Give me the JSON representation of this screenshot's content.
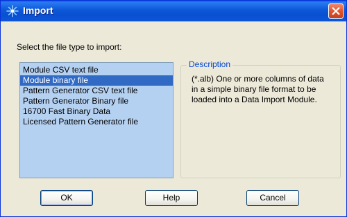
{
  "window": {
    "title": "Import"
  },
  "prompt": "Select the file type to import:",
  "file_types": [
    {
      "label": "Module CSV text file",
      "selected": false
    },
    {
      "label": "Module binary file",
      "selected": true
    },
    {
      "label": "Pattern Generator CSV text file",
      "selected": false
    },
    {
      "label": "Pattern Generator Binary file",
      "selected": false
    },
    {
      "label": "16700 Fast Binary Data",
      "selected": false
    },
    {
      "label": "Licensed Pattern Generator file",
      "selected": false
    }
  ],
  "description": {
    "title": "Description",
    "text": "(*.alb) One or more columns of data in a simple binary file format to be loaded into a Data Import Module."
  },
  "buttons": {
    "ok": "OK",
    "help": "Help",
    "cancel": "Cancel"
  },
  "colors": {
    "selection": "#316ac5",
    "listbox_bg": "#b5d1f2",
    "group_title": "#0046d5",
    "dialog_bg": "#ece9d8"
  },
  "icons": {
    "title": "sparkle-icon",
    "close": "close-icon"
  }
}
